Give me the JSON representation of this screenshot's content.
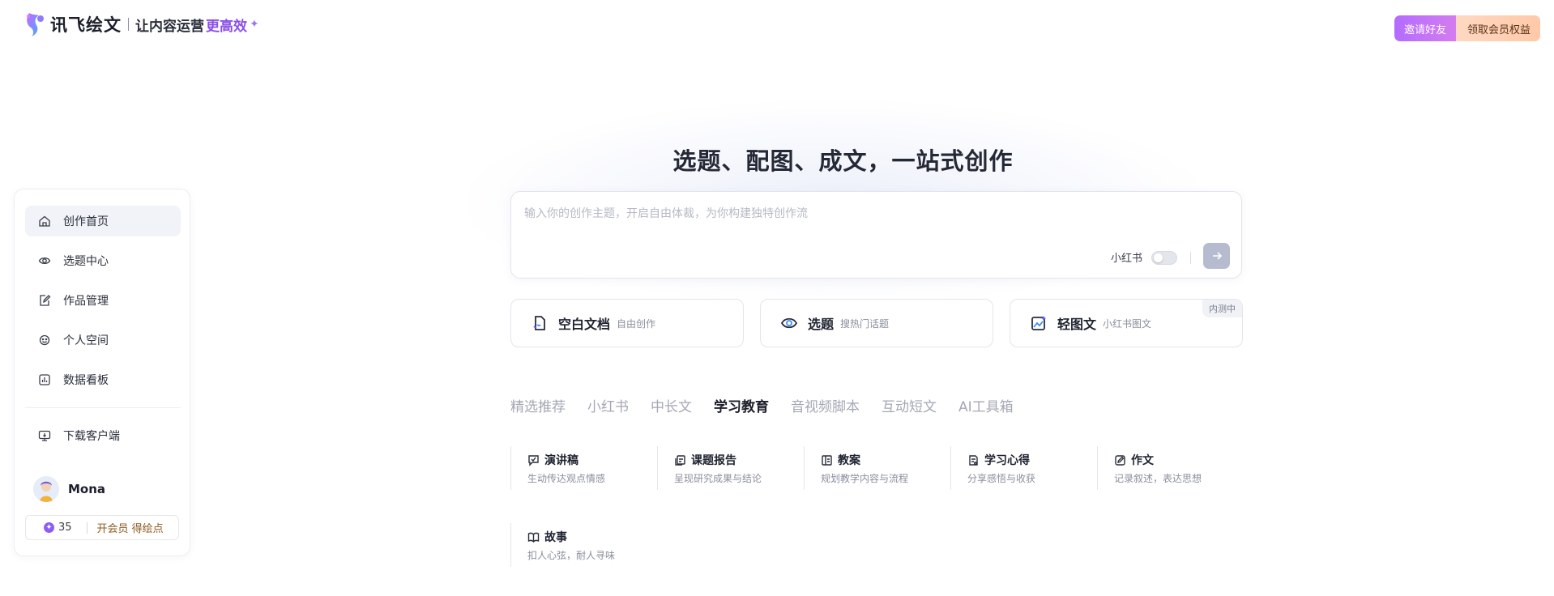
{
  "header": {
    "logo_name": "讯飞绘文",
    "slogan": "让内容运营",
    "slogan_highlight": "更高效",
    "invite_label": "邀请好友",
    "vip_label": "领取会员权益"
  },
  "sidebar": {
    "items": [
      {
        "label": "创作首页",
        "icon": "home-icon"
      },
      {
        "label": "选题中心",
        "icon": "eye-icon"
      },
      {
        "label": "作品管理",
        "icon": "edit-icon"
      },
      {
        "label": "个人空间",
        "icon": "user-space-icon"
      },
      {
        "label": "数据看板",
        "icon": "chart-icon"
      }
    ],
    "download": {
      "label": "下载客户端",
      "icon": "monitor-icon"
    },
    "user": {
      "name": "Mona"
    },
    "points": {
      "value": "35",
      "vip_label": "开会员 得绘点"
    }
  },
  "main": {
    "headline": "选题、配图、成文，一站式创作",
    "input": {
      "placeholder": "输入你的创作主题，开启自由体裁，为你构建独特创作流",
      "xhs_toggle_label": "小红书"
    },
    "cards": [
      {
        "title": "空白文档",
        "subtitle": "自由创作",
        "icon": "document-icon"
      },
      {
        "title": "选题",
        "subtitle": "搜热门话题",
        "icon": "eye-icon"
      },
      {
        "title": "轻图文",
        "subtitle": "小红书图文",
        "icon": "image-sparkle-icon",
        "badge": "内测中"
      }
    ],
    "tabs": [
      {
        "label": "精选推荐",
        "active": false
      },
      {
        "label": "小红书",
        "active": false
      },
      {
        "label": "中长文",
        "active": false
      },
      {
        "label": "学习教育",
        "active": true
      },
      {
        "label": "音视频脚本",
        "active": false
      },
      {
        "label": "互动短文",
        "active": false
      },
      {
        "label": "AI工具箱",
        "active": false
      }
    ],
    "templates": [
      {
        "title": "演讲稿",
        "desc": "生动传达观点情感",
        "icon": "speech-icon"
      },
      {
        "title": "课题报告",
        "desc": "呈现研究成果与结论",
        "icon": "report-icon"
      },
      {
        "title": "教案",
        "desc": "规划教学内容与流程",
        "icon": "lesson-plan-icon"
      },
      {
        "title": "学习心得",
        "desc": "分享感悟与收获",
        "icon": "notes-icon"
      },
      {
        "title": "作文",
        "desc": "记录叙述，表达思想",
        "icon": "essay-icon"
      },
      {
        "title": "故事",
        "desc": "扣人心弦，耐人寻味",
        "icon": "book-icon"
      }
    ]
  },
  "colors": {
    "brand_purple": "#8b4ee6",
    "send_button": "#b7bbd0",
    "active_nav_bg": "#f2f3f8"
  }
}
